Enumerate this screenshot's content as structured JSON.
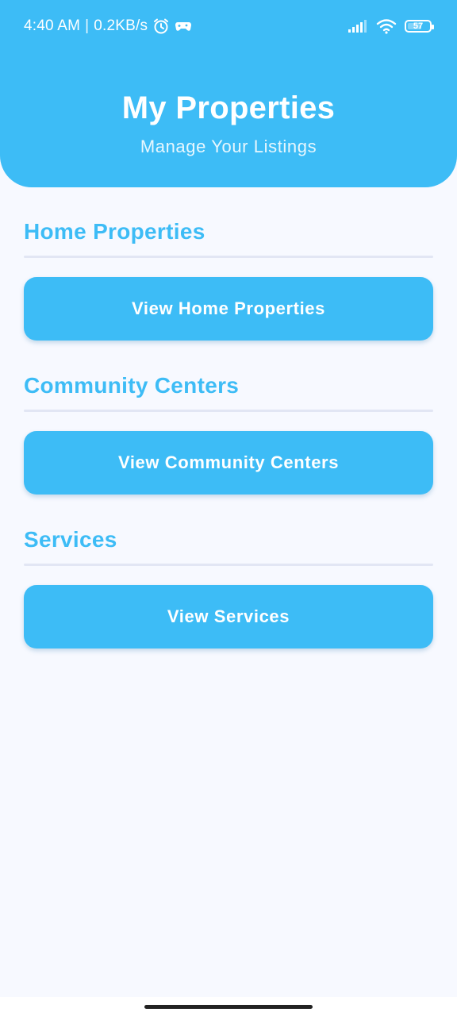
{
  "status_bar": {
    "time": "4:40 AM",
    "separator": "|",
    "speed": "0.2KB/s",
    "battery": "57",
    "icons": [
      "alarm-icon",
      "game-controller-icon",
      "signal-icon",
      "wifi-icon",
      "battery-icon"
    ]
  },
  "header": {
    "title": "My Properties",
    "subtitle": "Manage Your Listings"
  },
  "sections": [
    {
      "title": "Home Properties",
      "button_label": "View Home Properties"
    },
    {
      "title": "Community Centers",
      "button_label": "View Community Centers"
    },
    {
      "title": "Services",
      "button_label": "View Services"
    }
  ],
  "colors": {
    "primary": "#3dbcf6",
    "background": "#f7f9ff",
    "divider": "#e2e6f4"
  }
}
